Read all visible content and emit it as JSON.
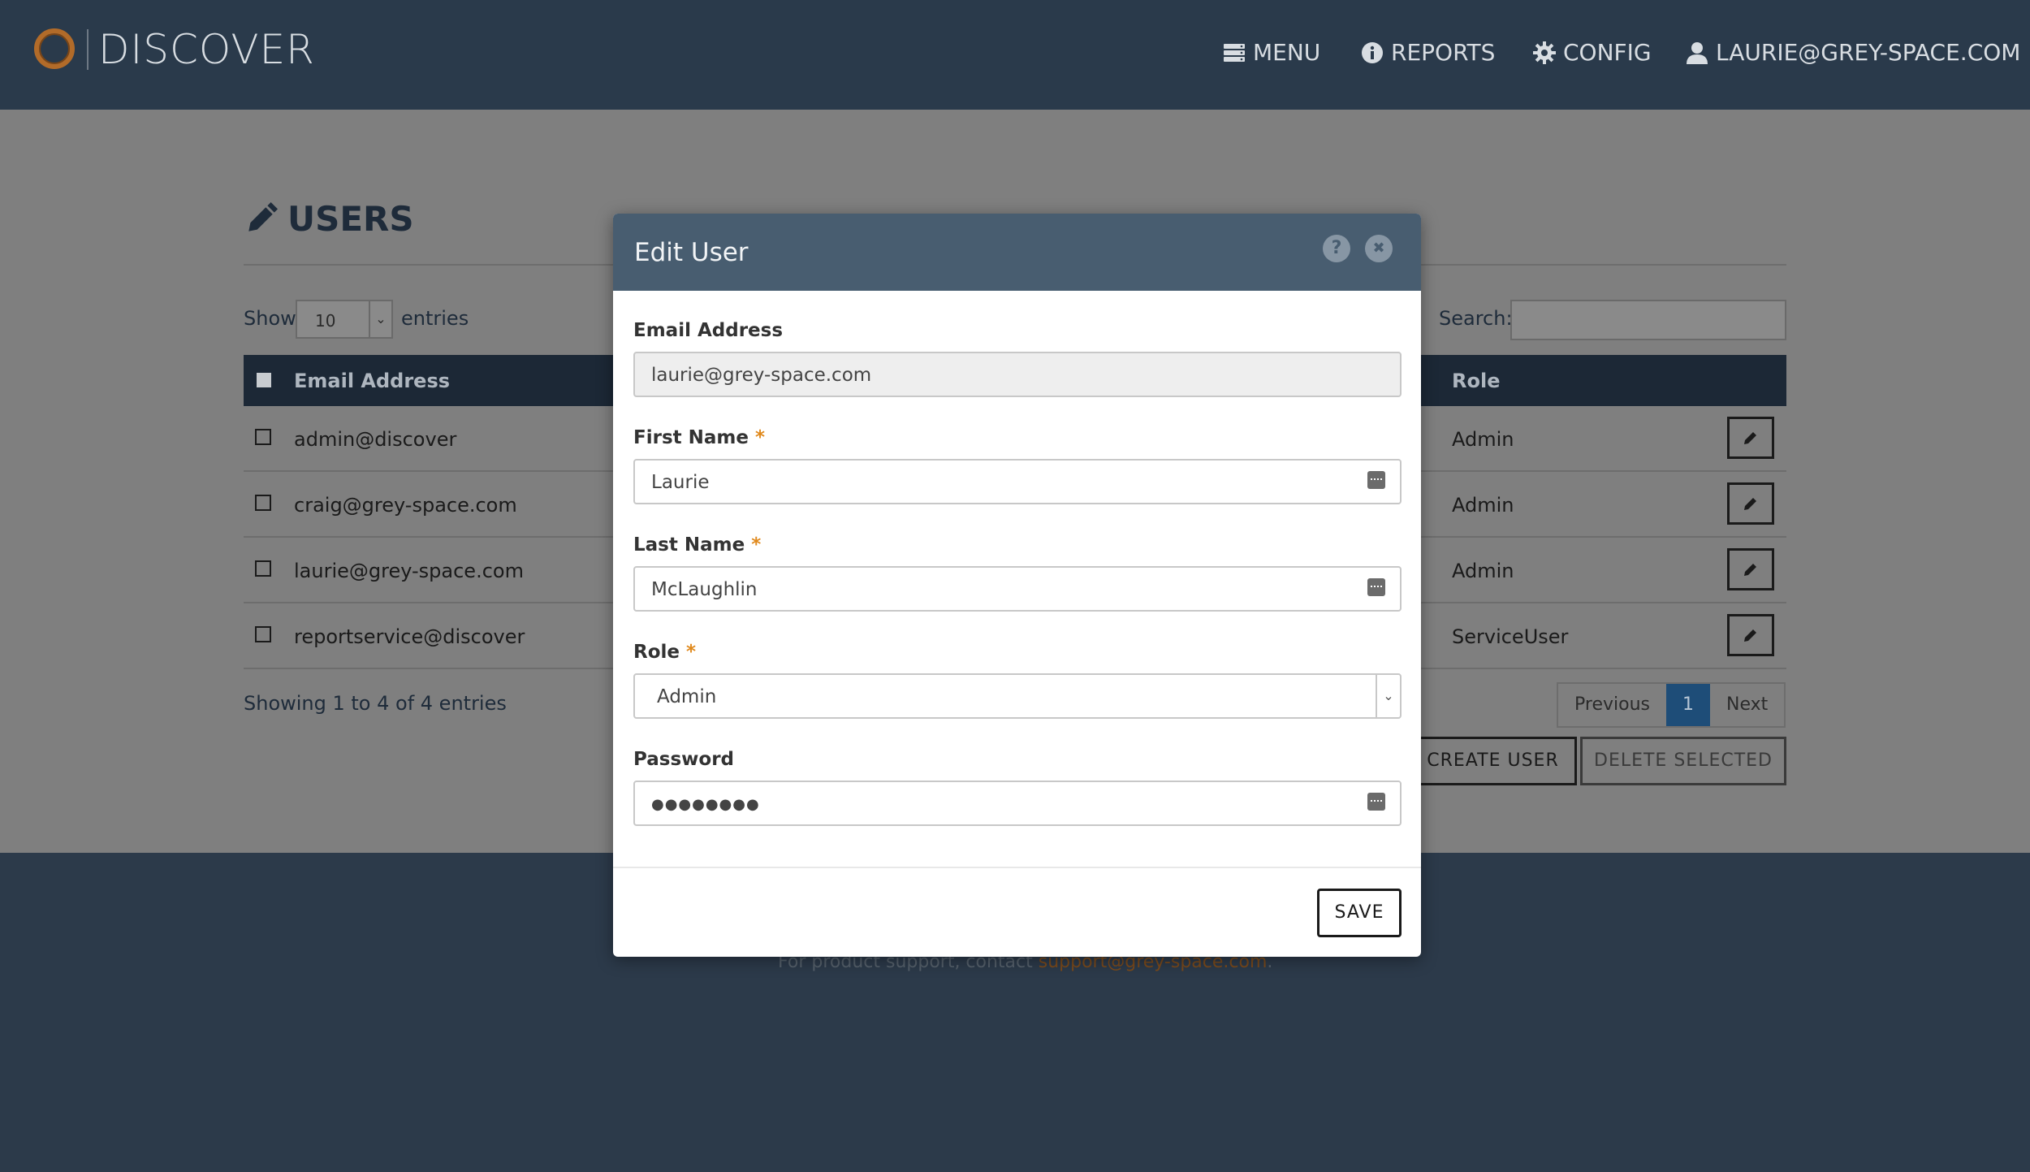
{
  "header": {
    "logo_text": "DISCOVER",
    "nav": {
      "menu": "MENU",
      "reports": "REPORTS",
      "config": "CONFIG",
      "user": "LAURIE@GREY-SPACE.COM"
    }
  },
  "page": {
    "title": "USERS",
    "show_label": "Show",
    "entries_value": "10",
    "entries_label": "entries",
    "search_label": "Search:",
    "table": {
      "columns": [
        "Email Address",
        "Role"
      ],
      "rows": [
        {
          "email": "admin@discover",
          "role": "Admin"
        },
        {
          "email": "craig@grey-space.com",
          "role": "Admin"
        },
        {
          "email": "laurie@grey-space.com",
          "role": "Admin"
        },
        {
          "email": "reportservice@discover",
          "role": "ServiceUser"
        }
      ]
    },
    "showing": "Showing 1 to 4 of 4 entries",
    "pager": {
      "previous": "Previous",
      "current": "1",
      "next": "Next"
    },
    "buttons": {
      "create": "CREATE USER",
      "delete": "DELETE SELECTED"
    }
  },
  "footer": {
    "text": "For product support, contact ",
    "link": "support@grey-space.com",
    "end": "."
  },
  "modal": {
    "title": "Edit User",
    "help_icon": "?",
    "close_icon": "✖",
    "fields": {
      "email": {
        "label": "Email Address",
        "value": "laurie@grey-space.com"
      },
      "first_name": {
        "label": "First Name",
        "value": "Laurie"
      },
      "last_name": {
        "label": "Last Name",
        "value": "McLaughlin"
      },
      "role": {
        "label": "Role",
        "value": "Admin"
      },
      "password": {
        "label": "Password",
        "value": "●●●●●●●●"
      }
    },
    "required_mark": "*",
    "save": "SAVE"
  },
  "colors": {
    "header_bg": "#2a3a4b",
    "modal_header_bg": "#485d70",
    "accent_orange": "#e08a1e",
    "pager_active": "#1e4d78"
  }
}
